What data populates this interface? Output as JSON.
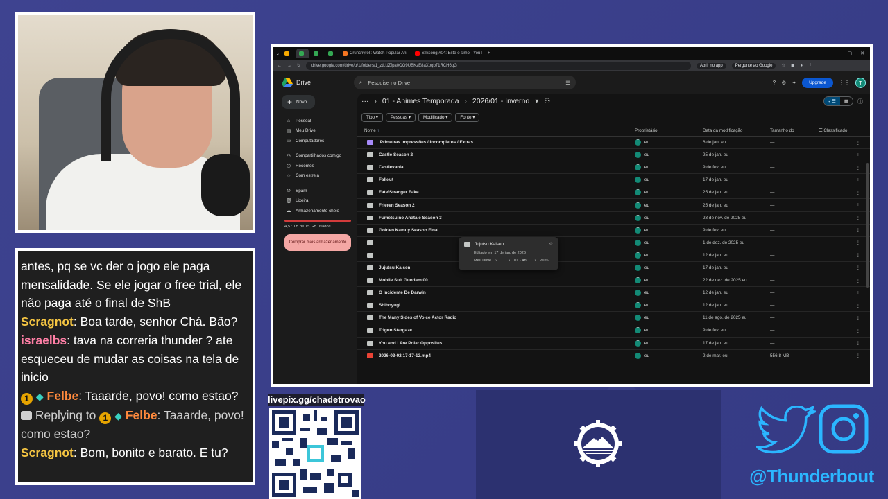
{
  "chat": {
    "cut_text": "...",
    "m1": "antes, pq se vc der o jogo ele paga mensalidade. Se ele jogar o free trial, ele não paga até o final de ShB",
    "m2_user": "Scragnot",
    "m2_text": ": Boa tarde, senhor Chá. Bão?",
    "m3_user": "israelbs",
    "m3_text": ": tava na correria thunder ? ate esqueceu de mudar as coisas na tela de inicio",
    "m4_badge": "1",
    "m4_user": "Felbe",
    "m4_text": ": Taaarde, povo! como estao?",
    "m5_prefix": " Replying to ",
    "m5_badge": "1",
    "m5_user": "Felbe",
    "m5_text": ": Taaarde, povo! como estao?",
    "m6_user": "Scragnot",
    "m6_text": ": Bom, bonito e barato. E tu?"
  },
  "livepix": {
    "label": "livepix.gg/chadetrovao"
  },
  "social": {
    "handle": "@Thunderbout"
  },
  "browser": {
    "tabs": [
      {
        "label": "",
        "color": "#f9ab00"
      },
      {
        "label": "",
        "color": "#34a853"
      },
      {
        "label": "",
        "color": "#34a853"
      },
      {
        "label": "Crunchyroll: Watch Popular Ani",
        "color": "#f47521"
      },
      {
        "label": "Silksong #04: Este o simo - YouT",
        "color": "#ff0000"
      }
    ],
    "url": "drive.google.com/drive/u/1/folders/1_ztLUZfpa0OO9UBKzE8aXoqb71RCH6qG",
    "open_app": "Abrir no app",
    "ask_google": "Pergunte ao Google"
  },
  "drive": {
    "logo": "Drive",
    "search_placeholder": "Pesquise no Drive",
    "upgrade": "Upgrade",
    "avatar_letter": "T",
    "new": "Novo",
    "nav": {
      "pessoal": "Pessoal",
      "meu_drive": "Meu Drive",
      "computadores": "Computadores",
      "compartilhados": "Compartilhados comigo",
      "recentes": "Recentes",
      "estrela": "Com estrela",
      "spam": "Spam",
      "lixeira": "Lixeira",
      "armazenamento": "Armazenamento cheio"
    },
    "storage_text": "4,57 TB de 15 GB usados",
    "buy_storage": "Comprar mais armazenamento",
    "breadcrumb": {
      "parent": "01 - Animes Temporada",
      "current": "2026/01 - Inverno"
    },
    "filters": {
      "tipo": "Tipo",
      "pessoas": "Pessoas",
      "modificado": "Modificado",
      "fonte": "Fonte"
    },
    "columns": {
      "name": "Nome",
      "owner": "Proprietário",
      "date": "Data da modificação",
      "size": "Tamanho do",
      "sort": "Classificado"
    },
    "rows": [
      {
        "name": ".Primeiras Impressões / Incompletos / Extras",
        "owner": "eu",
        "date": "6 de jan. eu",
        "size": "—",
        "type": "purple"
      },
      {
        "name": "Castle Season 2",
        "owner": "eu",
        "date": "25 de jan. eu",
        "size": "—",
        "type": "folder"
      },
      {
        "name": "Castlevania",
        "owner": "eu",
        "date": "9 de fev. eu",
        "size": "—",
        "type": "folder"
      },
      {
        "name": "Fallout",
        "owner": "eu",
        "date": "17 de jan. eu",
        "size": "—",
        "type": "folder"
      },
      {
        "name": "Fate/Stranger Fake",
        "owner": "eu",
        "date": "25 de jan. eu",
        "size": "—",
        "type": "folder"
      },
      {
        "name": "Frieren Season 2",
        "owner": "eu",
        "date": "25 de jan. eu",
        "size": "—",
        "type": "folder"
      },
      {
        "name": "Fumetsu no Anata e Season 3",
        "owner": "eu",
        "date": "23 de nov. de 2025 eu",
        "size": "—",
        "type": "folder"
      },
      {
        "name": "Golden Kamuy Season Final",
        "owner": "eu",
        "date": "9 de fev. eu",
        "size": "—",
        "type": "folder"
      },
      {
        "name": "",
        "owner": "eu",
        "date": "1 de dez. de 2025 eu",
        "size": "—",
        "type": "folder"
      },
      {
        "name": "",
        "owner": "eu",
        "date": "12 de jan. eu",
        "size": "—",
        "type": "folder"
      },
      {
        "name": "Jujutsu Kaisen",
        "owner": "eu",
        "date": "17 de jan. eu",
        "size": "—",
        "type": "folder"
      },
      {
        "name": "Mobile Suit Gundam 00",
        "owner": "eu",
        "date": "22 de dez. de 2025 eu",
        "size": "—",
        "type": "folder"
      },
      {
        "name": "O Incidente De Darwin",
        "owner": "eu",
        "date": "12 de jan. eu",
        "size": "—",
        "type": "folder"
      },
      {
        "name": "Shiboyugi",
        "owner": "eu",
        "date": "12 de jan. eu",
        "size": "—",
        "type": "folder"
      },
      {
        "name": "The Many Sides of Voice Actor Radio",
        "owner": "eu",
        "date": "11 de ago. de 2025 eu",
        "size": "—",
        "type": "folder"
      },
      {
        "name": "Trigun Stargaze",
        "owner": "eu",
        "date": "9 de fev. eu",
        "size": "—",
        "type": "folder"
      },
      {
        "name": "You and I Are Polar Opposites",
        "owner": "eu",
        "date": "17 de jan. eu",
        "size": "—",
        "type": "folder"
      },
      {
        "name": "2026-03-02 17-17-12.mp4",
        "owner": "eu",
        "date": "2 de mar. eu",
        "size": "556,8 MB",
        "type": "video"
      }
    ],
    "tooltip": {
      "title": "Jujutsu Kaisen",
      "edited": "Editado em 17 de jan. de 2026",
      "path1": "Meu Drive",
      "path2": "01 - Ani...",
      "path3": "2026/..."
    }
  },
  "colors": {
    "background": "#3b3f8c",
    "accent": "#2bb6ff",
    "drive_blue": "#0b57d0"
  }
}
